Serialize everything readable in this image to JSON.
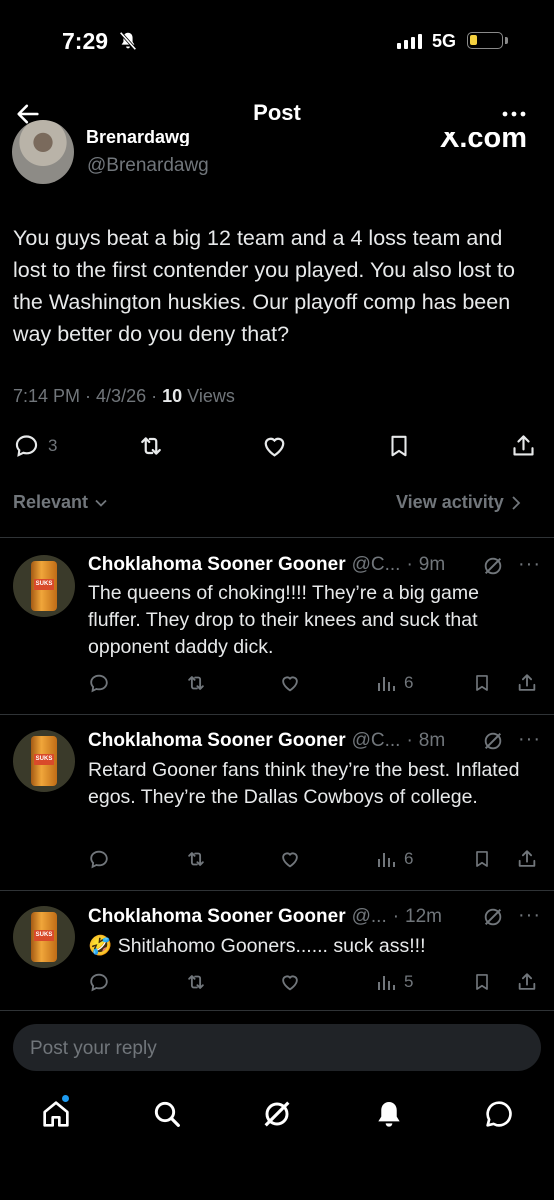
{
  "status_bar": {
    "time": "7:29",
    "network": "5G"
  },
  "header": {
    "title": "Post"
  },
  "post": {
    "author_name": "Brenardawg",
    "author_handle": "@Brenardawg",
    "watermark": "X.com",
    "text": "You guys beat a big 12 team and a 4 loss team and lost to the first contender you played. You also lost to the Washington huskies. Our playoff comp has been way better do you deny that?",
    "time": "7:14 PM",
    "date": "4/3/26",
    "views_count": "10",
    "views_label": "Views",
    "reply_count": "3"
  },
  "sort": {
    "label": "Relevant",
    "view_activity": "View activity"
  },
  "replies": [
    {
      "name": "Choklahoma Sooner Gooner",
      "handle": "@C...",
      "time": "9m",
      "text": "The queens of choking!!!! They’re a big game fluffer. They drop to their knees and suck that opponent daddy dick.",
      "views": "6",
      "can_label": "SUKS"
    },
    {
      "name": "Choklahoma Sooner Gooner",
      "handle": "@C...",
      "time": "8m",
      "text": "Retard Gooner fans think they’re the best. Inflated egos. They’re the Dallas Cowboys of college.",
      "views": "6",
      "can_label": "SUKS"
    },
    {
      "name": "Choklahoma Sooner Gooner",
      "handle": "@...",
      "time": "12m",
      "text": "🤣 Shitlahomo Gooners...... suck ass!!!",
      "views": "5",
      "can_label": "SUKS"
    }
  ],
  "composer": {
    "placeholder": "Post your reply"
  },
  "colors": {
    "background": "#000000",
    "text": "#e7e9ea",
    "muted": "#71767b",
    "accent": "#1d9bf0",
    "divider": "#2f3336"
  }
}
